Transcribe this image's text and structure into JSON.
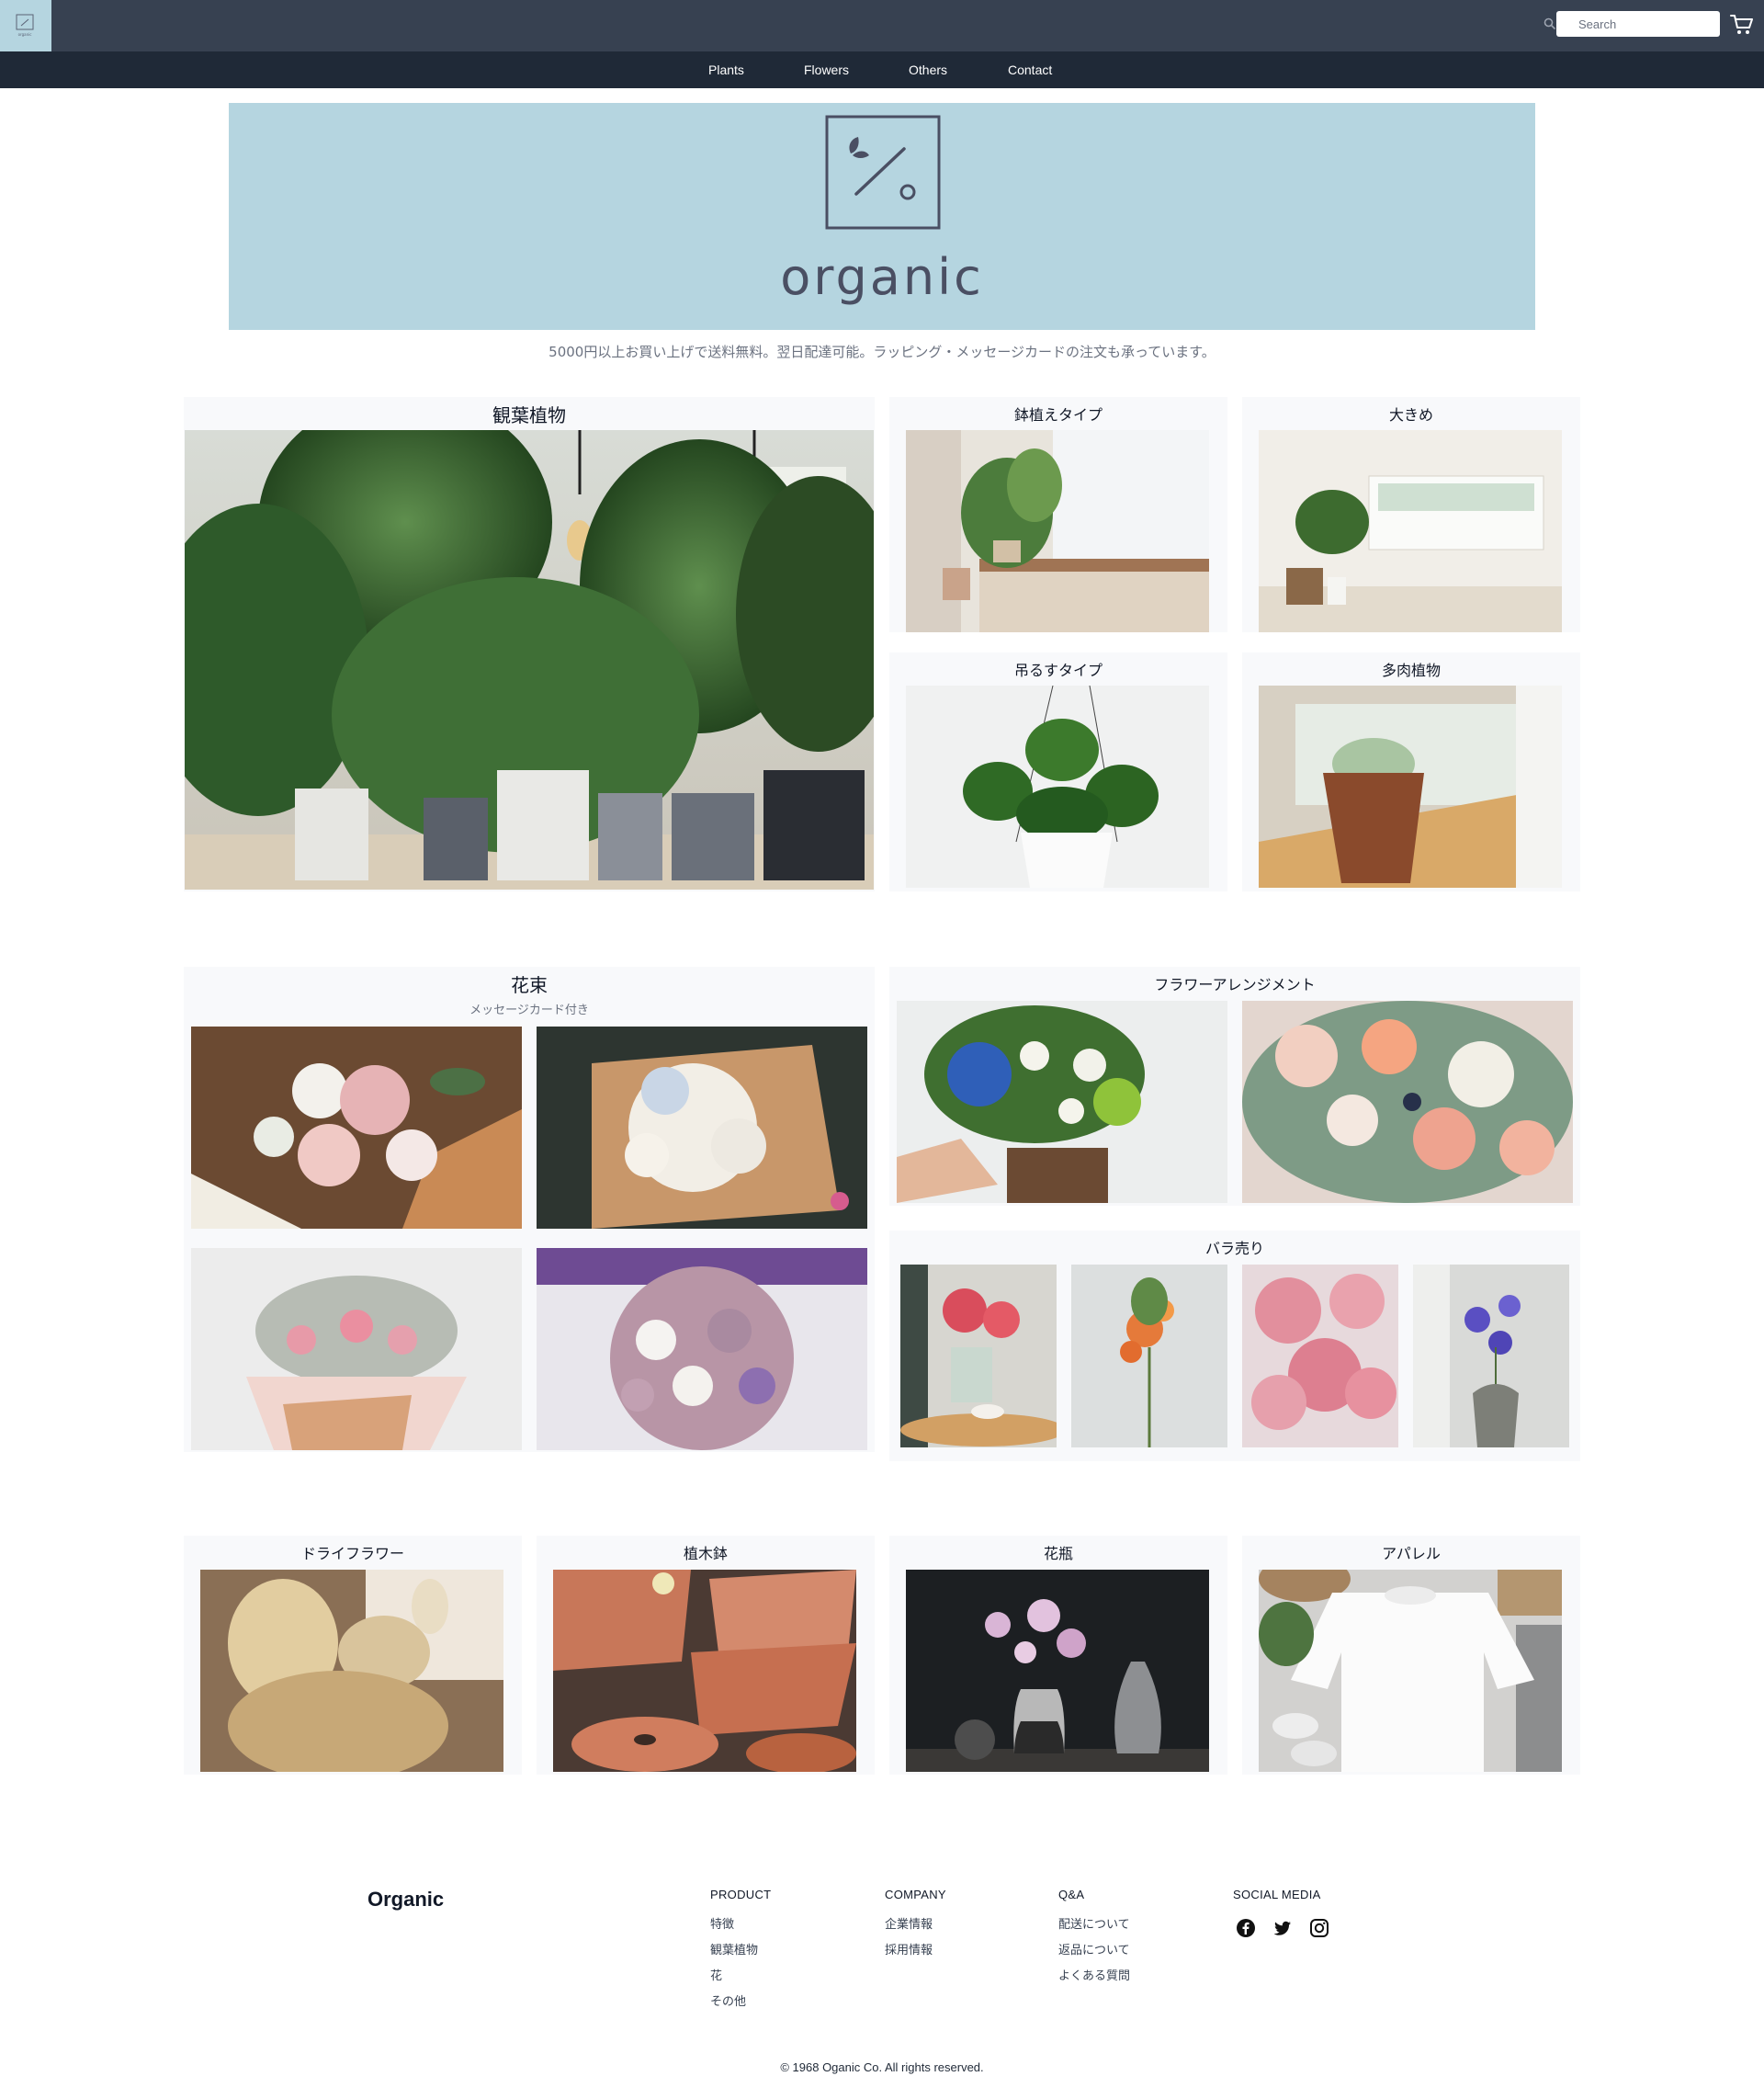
{
  "header": {
    "search_placeholder": "Search",
    "logo_text": "organic"
  },
  "nav": {
    "items": [
      "Plants",
      "Flowers",
      "Others",
      "Contact"
    ]
  },
  "banner": {
    "wordmark": "organic",
    "tagline": "5000円以上お買い上げで送料無料。翌日配達可能。ラッピング・メッセージカードの注文も承っています。"
  },
  "plants": {
    "main_title": "観葉植物",
    "potted_title": "鉢植えタイプ",
    "large_title": "大きめ",
    "hanging_title": "吊るすタイプ",
    "succulent_title": "多肉植物"
  },
  "flowers": {
    "bouquet_title": "花束",
    "bouquet_subtitle": "メッセージカード付き",
    "arrangement_title": "フラワーアレンジメント",
    "single_title": "バラ売り"
  },
  "others": {
    "dried_title": "ドライフラワー",
    "pots_title": "植木鉢",
    "vase_title": "花瓶",
    "apparel_title": "アパレル"
  },
  "footer": {
    "brand": "Organic",
    "columns": [
      {
        "heading": "PRODUCT",
        "links": [
          "特徴",
          "観葉植物",
          "花",
          "その他"
        ]
      },
      {
        "heading": "COMPANY",
        "links": [
          "企業情報",
          "採用情報"
        ]
      },
      {
        "heading": "Q&A",
        "links": [
          "配送について",
          "返品について",
          "よくある質問"
        ]
      },
      {
        "heading": "SOCIAL MEDIA",
        "icons": [
          "facebook-icon",
          "twitter-icon",
          "instagram-icon"
        ]
      }
    ],
    "copyright": "© 1968 Oganic Co. All rights reserved."
  },
  "colors": {
    "topbar": "#374151",
    "navbar": "#1f2937",
    "banner": "#b5d5e0",
    "card": "#f8f9fb"
  }
}
